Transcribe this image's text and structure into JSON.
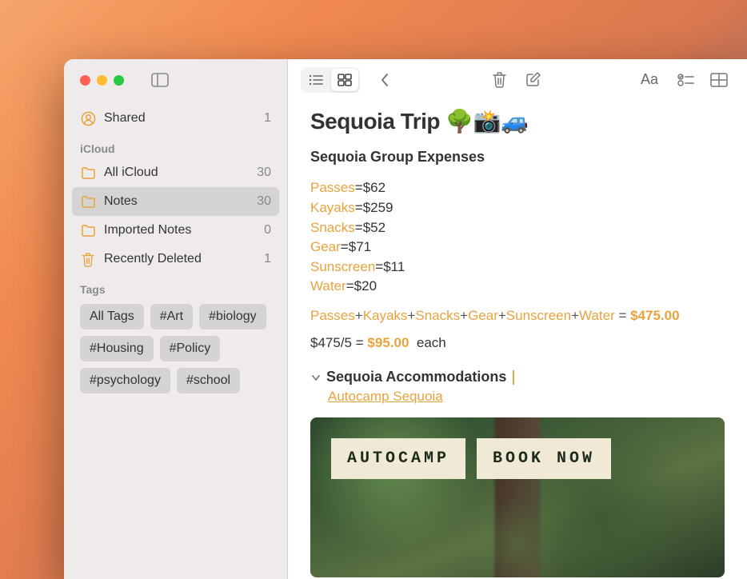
{
  "sidebar": {
    "shared": {
      "label": "Shared",
      "count": "1"
    },
    "section_icloud": "iCloud",
    "folders": [
      {
        "label": "All iCloud",
        "count": "30",
        "selected": false
      },
      {
        "label": "Notes",
        "count": "30",
        "selected": true
      },
      {
        "label": "Imported Notes",
        "count": "0",
        "selected": false
      },
      {
        "label": "Recently Deleted",
        "count": "1",
        "selected": false,
        "trash": true
      }
    ],
    "section_tags": "Tags",
    "tags": [
      "All Tags",
      "#Art",
      "#biology",
      "#Housing",
      "#Policy",
      "#psychology",
      "#school"
    ]
  },
  "note": {
    "title": "Sequoia Trip 🌳📸🚙",
    "subheading": "Sequoia Group Expenses",
    "expenses": [
      {
        "name": "Passes",
        "value": "$62"
      },
      {
        "name": "Kayaks",
        "value": "$259"
      },
      {
        "name": "Snacks",
        "value": "$52"
      },
      {
        "name": "Gear",
        "value": "$71"
      },
      {
        "name": "Sunscreen",
        "value": "$11"
      },
      {
        "name": "Water",
        "value": "$20"
      }
    ],
    "formula_items": [
      "Passes",
      "Kayaks",
      "Snacks",
      "Gear",
      "Sunscreen",
      "Water"
    ],
    "formula_total": "$475.00",
    "each_prefix": "$475/5",
    "each_equals": "=",
    "each_value": "$95.00",
    "each_suffix": "each",
    "accommodations_heading": "Sequoia Accommodations",
    "link_text": "Autocamp Sequoia",
    "image_buttons": [
      "AUTOCAMP",
      "BOOK NOW"
    ]
  }
}
